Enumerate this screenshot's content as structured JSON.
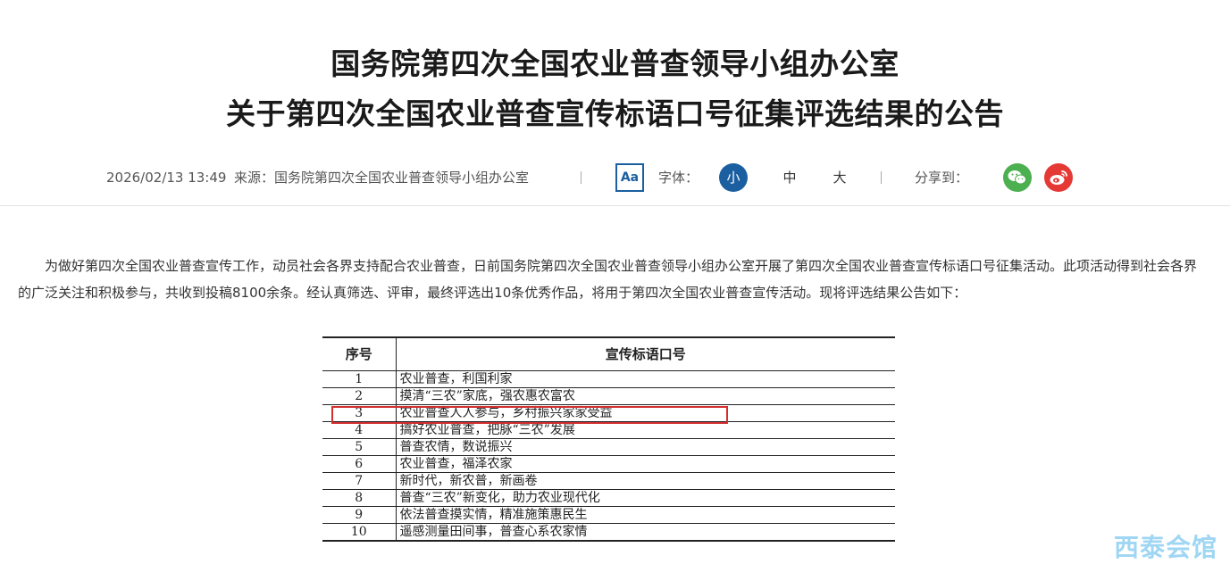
{
  "title": {
    "line1": "国务院第四次全国农业普查领导小组办公室",
    "line2": "关于第四次全国农业普查宣传标语口号征集评选结果的公告"
  },
  "meta": {
    "date": "2026/02/13 13:49",
    "source": "来源：国务院第四次全国农业普查领导小组办公室",
    "font_icon_text": "Aa",
    "font_label": "字体：",
    "size_small": "小",
    "size_medium": "中",
    "size_large": "大",
    "share_label": "分享到："
  },
  "body": {
    "paragraph": "为做好第四次全国农业普查宣传工作，动员社会各界支持配合农业普查，日前国务院第四次全国农业普查领导小组办公室开展了第四次全国农业普查宣传标语口号征集活动。此项活动得到社会各界的广泛关注和积极参与，共收到投稿8100余条。经认真筛选、评审，最终评选出10条优秀作品，将用于第四次全国农业普查宣传活动。现将评选结果公告如下："
  },
  "table": {
    "headers": [
      "序号",
      "宣传标语口号"
    ],
    "rows": [
      {
        "no": "1",
        "text": "农业普查，利国利家"
      },
      {
        "no": "2",
        "text": "摸清“三农”家底，强农惠农富农"
      },
      {
        "no": "3",
        "text": "农业普查人人参与，乡村振兴家家受益"
      },
      {
        "no": "4",
        "text": "搞好农业普查，把脉“三农”发展"
      },
      {
        "no": "5",
        "text": "普查农情，数说振兴"
      },
      {
        "no": "6",
        "text": "农业普查，福泽农家"
      },
      {
        "no": "7",
        "text": "新时代，新农普，新画卷"
      },
      {
        "no": "8",
        "text": "普查“三农”新变化，助力农业现代化"
      },
      {
        "no": "9",
        "text": "依法普查摸实情，精准施策惠民生"
      },
      {
        "no": "10",
        "text": "遥感测量田间事，普查心系农家情"
      }
    ]
  },
  "watermark": "西泰会馆",
  "colors": {
    "accent": "#1b5fa0",
    "wechat": "#4caf50",
    "weibo": "#e53935",
    "highlight": "#d32f2f",
    "watermark": "#8fd0f2"
  },
  "icons": [
    "font-size-icon",
    "wechat-icon",
    "weibo-icon"
  ]
}
